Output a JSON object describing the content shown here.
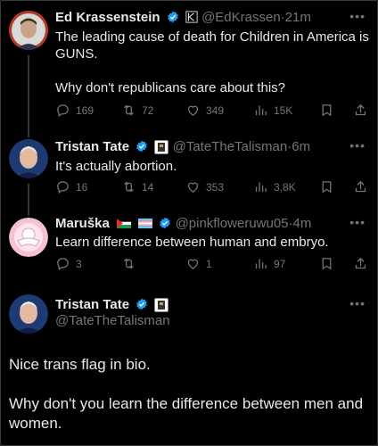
{
  "tweets": [
    {
      "name": "Ed Krassenstein",
      "handle": "@EdKrassen",
      "time": "21m",
      "text_line1": "The leading cause of death for Children in America is",
      "text_line2": "GUNS.",
      "text_line3": "Why don't republicans care about this?",
      "replies": "169",
      "retweets": "72",
      "likes": "349",
      "views": "15K"
    },
    {
      "name": "Tristan Tate",
      "handle": "@TateTheTalisman",
      "time": "6m",
      "text_line1": "It's actually abortion.",
      "replies": "16",
      "retweets": "14",
      "likes": "353",
      "views": "3,8K"
    },
    {
      "name": "Maruška",
      "handle": "@pinkfloweruwu05",
      "time": "4m",
      "text_line1": "Learn difference between human and embryo.",
      "replies": "3",
      "retweets": "",
      "likes": "1",
      "views": "97"
    }
  ],
  "focused": {
    "name": "Tristan Tate",
    "handle": "@TateTheTalisman",
    "para1": "Nice trans flag in bio.",
    "para2_line1": "Why don't you learn the difference between men and",
    "para2_line2": "women."
  },
  "more_label": "•••",
  "dot": "·",
  "colors": {
    "accent": "#1d9bf0",
    "muted": "#71767b",
    "text": "#e7e9ea",
    "background": "#000000"
  }
}
